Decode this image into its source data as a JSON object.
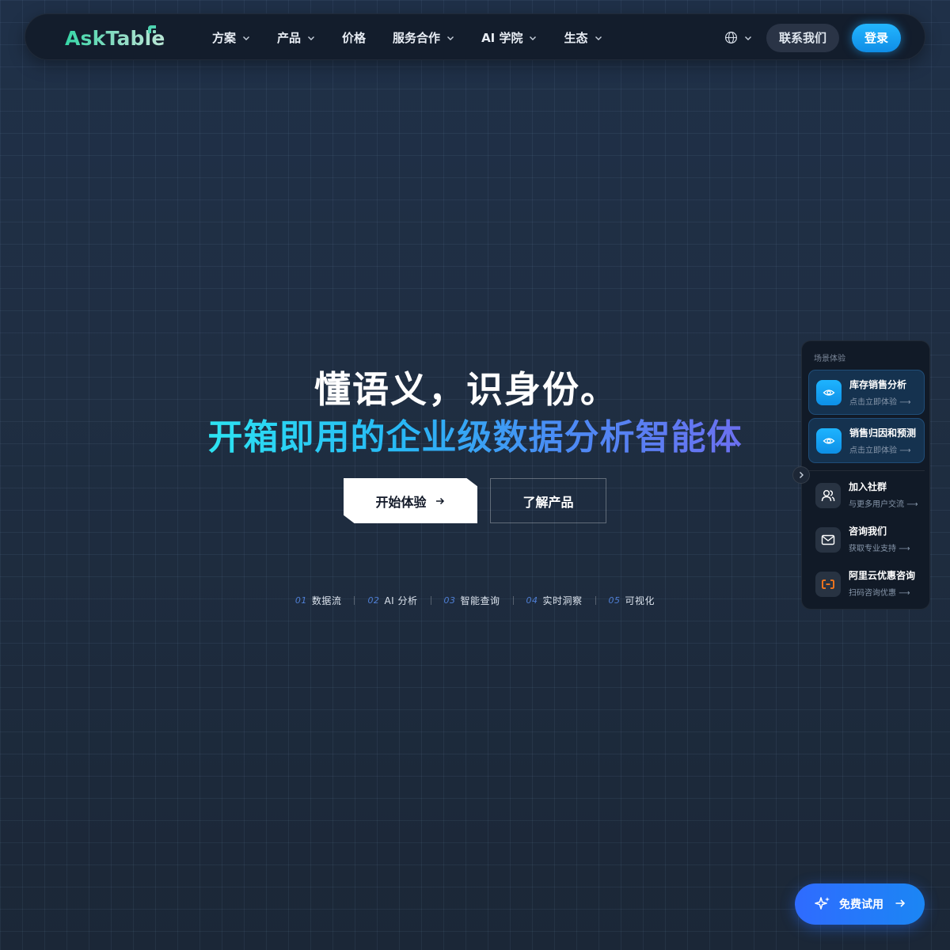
{
  "brand": {
    "name": "AskTable"
  },
  "nav": {
    "items": [
      {
        "label": "方案",
        "has_dropdown": true
      },
      {
        "label": "产品",
        "has_dropdown": true
      },
      {
        "label": "价格",
        "has_dropdown": false
      },
      {
        "label": "服务合作",
        "has_dropdown": true
      },
      {
        "label": "AI 学院",
        "has_dropdown": true
      },
      {
        "label": "生态",
        "has_dropdown": true
      }
    ],
    "language_icon": "globe-icon",
    "contact_label": "联系我们",
    "login_label": "登录"
  },
  "hero": {
    "title_line1": "懂语义，识身份。",
    "title_line2": "开箱即用的企业级数据分析智能体",
    "primary_cta": "开始体验",
    "secondary_cta": "了解产品",
    "features": [
      {
        "num": "01",
        "label": "数据流"
      },
      {
        "num": "02",
        "label": "AI 分析"
      },
      {
        "num": "03",
        "label": "智能查询"
      },
      {
        "num": "04",
        "label": "实时洞察"
      },
      {
        "num": "05",
        "label": "可视化"
      }
    ]
  },
  "side_panel": {
    "title": "场景体验",
    "scenes": [
      {
        "title": "库存销售分析",
        "subtitle": "点击立即体验",
        "icon": "eye-icon"
      },
      {
        "title": "销售归因和预测",
        "subtitle": "点击立即体验",
        "icon": "eye-icon"
      }
    ],
    "links": [
      {
        "title": "加入社群",
        "subtitle": "与更多用户交流",
        "icon": "users-icon"
      },
      {
        "title": "咨询我们",
        "subtitle": "获取专业支持",
        "icon": "mail-icon"
      },
      {
        "title": "阿里云优惠咨询",
        "subtitle": "扫码咨询优惠",
        "icon": "aliyun-icon"
      }
    ]
  },
  "free_trial": {
    "label": "免费试用",
    "icon": "sparkles-icon"
  },
  "colors": {
    "background": "#1d2a3b",
    "navbar": "#131d2c",
    "login_button": "#1aa6f5",
    "brand_gradient_start": "#36d6a6",
    "headline_gradient_start": "#2de3f2",
    "headline_gradient_end": "#6c6ff0",
    "free_trial": "#2f6bff",
    "aliyun_orange": "#ff7a1a"
  }
}
